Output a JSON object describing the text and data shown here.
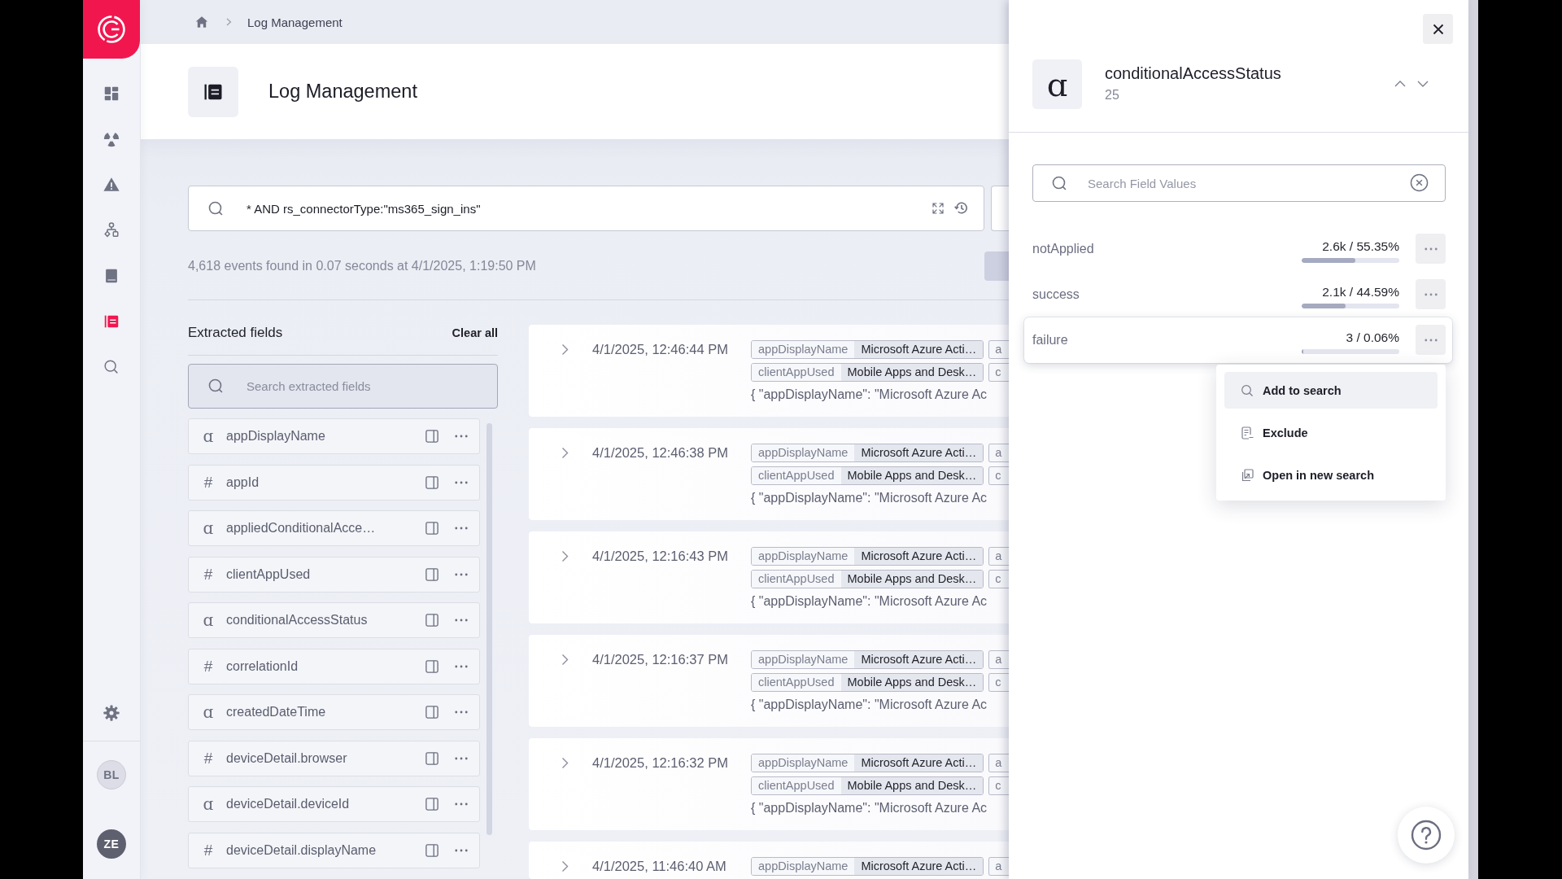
{
  "sidebar": {
    "nav": [
      {
        "selected": false
      },
      {
        "selected": false
      },
      {
        "selected": false
      },
      {
        "selected": false
      },
      {
        "selected": false
      },
      {
        "selected": true
      },
      {
        "selected": false
      }
    ],
    "avatars": [
      {
        "initials": "BL",
        "color": "#dcdde6"
      },
      {
        "initials": "ZE",
        "color": "#5e606f"
      }
    ]
  },
  "breadcrumb": {
    "current": "Log Management"
  },
  "header": {
    "title": "Log Management"
  },
  "query": {
    "value": "* AND rs_connectorType:\"ms365_sign_ins\""
  },
  "summary": "4,618 events found in 0.07 seconds at 4/1/2025, 1:19:50 PM",
  "extracted_fields": {
    "title": "Extracted fields",
    "clear_label": "Clear all",
    "search_placeholder": "Search extracted fields",
    "fields": [
      {
        "type_icon": "ɑ",
        "name": "appDisplayName"
      },
      {
        "type_icon": "#",
        "name": "appId"
      },
      {
        "type_icon": "ɑ",
        "name": "appliedConditionalAcce…"
      },
      {
        "type_icon": "#",
        "name": "clientAppUsed"
      },
      {
        "type_icon": "ɑ",
        "name": "conditionalAccessStatus"
      },
      {
        "type_icon": "#",
        "name": "correlationId"
      },
      {
        "type_icon": "ɑ",
        "name": "createdDateTime"
      },
      {
        "type_icon": "#",
        "name": "deviceDetail.browser"
      },
      {
        "type_icon": "ɑ",
        "name": "deviceDetail.deviceId"
      },
      {
        "type_icon": "#",
        "name": "deviceDetail.displayName"
      }
    ]
  },
  "events": [
    {
      "time": "4/1/2025, 12:46:44 PM",
      "tag_rows": [
        {
          "tags": [
            {
              "key": "appDisplayName",
              "value": "Microsoft Azure Acti…"
            },
            {
              "key": "a"
            }
          ]
        },
        {
          "tags": [
            {
              "key": "clientAppUsed",
              "value": "Mobile Apps and Desk…"
            },
            {
              "key": "c"
            }
          ]
        }
      ],
      "preview": "{ \"appDisplayName\": \"Microsoft Azure Ac"
    },
    {
      "time": "4/1/2025, 12:46:38 PM",
      "tag_rows": [
        {
          "tags": [
            {
              "key": "appDisplayName",
              "value": "Microsoft Azure Acti…"
            },
            {
              "key": "a"
            }
          ]
        },
        {
          "tags": [
            {
              "key": "clientAppUsed",
              "value": "Mobile Apps and Desk…"
            },
            {
              "key": "c"
            }
          ]
        }
      ],
      "preview": "{ \"appDisplayName\": \"Microsoft Azure Ac"
    },
    {
      "time": "4/1/2025, 12:16:43 PM",
      "tag_rows": [
        {
          "tags": [
            {
              "key": "appDisplayName",
              "value": "Microsoft Azure Acti…"
            },
            {
              "key": "a"
            }
          ]
        },
        {
          "tags": [
            {
              "key": "clientAppUsed",
              "value": "Mobile Apps and Desk…"
            },
            {
              "key": "c"
            }
          ]
        }
      ],
      "preview": "{ \"appDisplayName\": \"Microsoft Azure Ac"
    },
    {
      "time": "4/1/2025, 12:16:37 PM",
      "tag_rows": [
        {
          "tags": [
            {
              "key": "appDisplayName",
              "value": "Microsoft Azure Acti…"
            },
            {
              "key": "a"
            }
          ]
        },
        {
          "tags": [
            {
              "key": "clientAppUsed",
              "value": "Mobile Apps and Desk…"
            },
            {
              "key": "c"
            }
          ]
        }
      ],
      "preview": "{ \"appDisplayName\": \"Microsoft Azure Ac"
    },
    {
      "time": "4/1/2025, 12:16:32 PM",
      "tag_rows": [
        {
          "tags": [
            {
              "key": "appDisplayName",
              "value": "Microsoft Azure Acti…"
            },
            {
              "key": "a"
            }
          ]
        },
        {
          "tags": [
            {
              "key": "clientAppUsed",
              "value": "Mobile Apps and Desk…"
            },
            {
              "key": "c"
            }
          ]
        }
      ],
      "preview": "{ \"appDisplayName\": \"Microsoft Azure Ac"
    },
    {
      "time": "4/1/2025, 11:46:40 AM",
      "tag_rows": [
        {
          "tags": [
            {
              "key": "appDisplayName",
              "value": "Microsoft Azure Acti…"
            },
            {
              "key": "a"
            }
          ]
        }
      ]
    }
  ],
  "field_panel": {
    "type_icon": "ɑ",
    "name": "conditionalAccessStatus",
    "count": "25",
    "search_placeholder": "Search Field Values",
    "values": [
      {
        "label": "notApplied",
        "stat": "2.6k / 55.35%",
        "level": 0.5535,
        "active": false
      },
      {
        "label": "success",
        "stat": "2.1k / 44.59%",
        "level": 0.4459,
        "active": false
      },
      {
        "label": "failure",
        "stat": "3 / 0.06%",
        "level": 0.0006,
        "active": true
      }
    ],
    "menu": [
      {
        "label": "Add to search",
        "selected": true
      },
      {
        "label": "Exclude",
        "selected": false
      },
      {
        "label": "Open in new search",
        "selected": false
      }
    ]
  }
}
